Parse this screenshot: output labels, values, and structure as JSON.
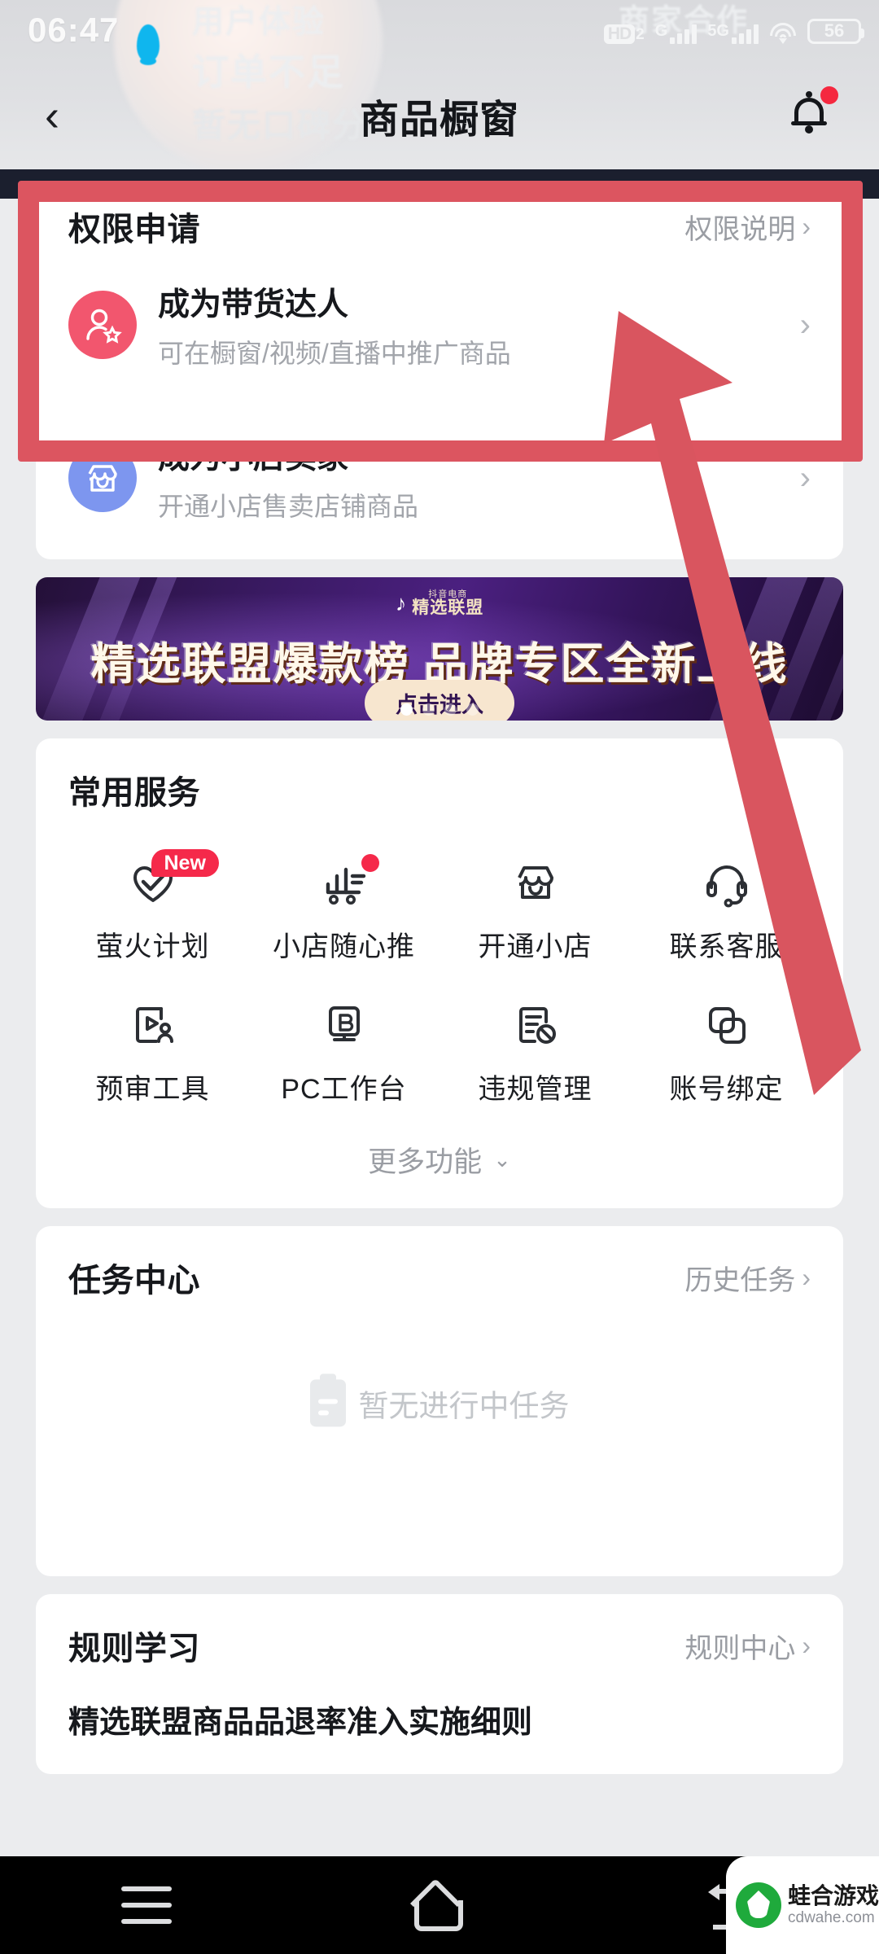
{
  "status_bar": {
    "time": "06:47",
    "hd_label": "HD",
    "hd_sub": "2",
    "net1_label": "G",
    "net2_label": "5G",
    "battery_level": "56",
    "wifi_icon": "wifi-icon"
  },
  "ghost_background": {
    "user_experience": "用户体验",
    "insufficient_orders": "订单不足",
    "no_reputation_score": "暂无口碑分 ›",
    "merchant_cooperation": "商家合作"
  },
  "header": {
    "back_icon": "‹",
    "title": "商品橱窗",
    "bell_icon": "bell-icon",
    "has_notification": true
  },
  "permission_card": {
    "title": "权限申请",
    "more_label": "权限说明",
    "more_chevron": "›",
    "rows": [
      {
        "icon": "talent-avatar-icon",
        "icon_color": "#f2566e",
        "title": "成为带货达人",
        "subtitle": "可在橱窗/视频/直播中推广商品",
        "chevron": "›"
      },
      {
        "icon": "shop-store-icon",
        "icon_color": "#7d96ef",
        "title": "成为小店卖家",
        "subtitle": "开通小店售卖店铺商品",
        "chevron": "›"
      }
    ]
  },
  "banner": {
    "logo_top": "抖音电商",
    "logo_main": "精选联盟",
    "note_icon": "music-note-icon",
    "headline": "精选联盟爆款榜 品牌专区全新上线",
    "cta": "点击进入",
    "dots_total": 4,
    "dot_active_index": 0
  },
  "services": {
    "title": "常用服务",
    "items": [
      {
        "icon": "heart-check-icon",
        "label": "萤火计划",
        "badge": "New",
        "dot": false
      },
      {
        "icon": "chart-cart-icon",
        "label": "小店随心推",
        "badge": null,
        "dot": true
      },
      {
        "icon": "store-icon",
        "label": "开通小店",
        "badge": null,
        "dot": false
      },
      {
        "icon": "headset-icon",
        "label": "联系客服",
        "badge": null,
        "dot": false
      },
      {
        "icon": "video-review-icon",
        "label": "预审工具",
        "badge": null,
        "dot": false
      },
      {
        "icon": "pc-workbench-icon",
        "label": "PC工作台",
        "badge": null,
        "dot": false
      },
      {
        "icon": "violation-doc-icon",
        "label": "违规管理",
        "badge": null,
        "dot": false
      },
      {
        "icon": "link-bind-icon",
        "label": "账号绑定",
        "badge": null,
        "dot": false
      }
    ],
    "more_label": "更多功能",
    "more_chevron": "⌄"
  },
  "task_center": {
    "title": "任务中心",
    "more_label": "历史任务",
    "more_chevron": "›",
    "empty_icon": "clipboard-icon",
    "empty_text": "暂无进行中任务"
  },
  "rules": {
    "title": "规则学习",
    "more_label": "规则中心",
    "more_chevron": "›",
    "items": [
      "精选联盟商品品退率准入实施细则"
    ]
  },
  "nav_bar": {
    "recents_icon": "recents-icon",
    "home_icon": "home-icon",
    "back_icon": "back-icon"
  },
  "watermark": {
    "name": "蛙合游戏",
    "url": "cdwahe.com"
  },
  "annotation": {
    "box_color": "#dc5560",
    "arrow_color": "#d9555f"
  }
}
